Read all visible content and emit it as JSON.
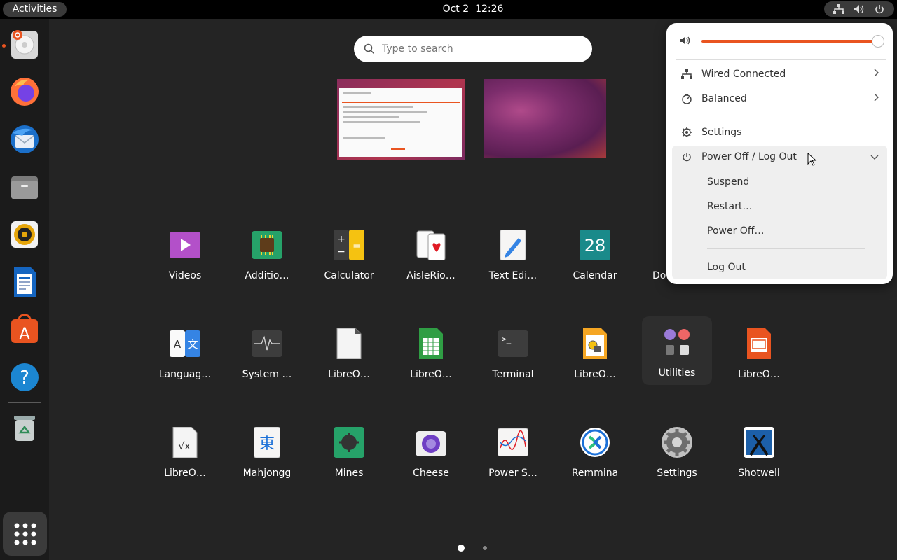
{
  "topbar": {
    "activities": "Activities",
    "date": "Oct 2",
    "time": "12:26"
  },
  "tray": {
    "icons": [
      "network-icon",
      "volume-icon",
      "power-icon"
    ]
  },
  "dock": {
    "items": [
      "Ubuntu Installer",
      "Firefox",
      "Thunderbird",
      "Files",
      "Rhythmbox",
      "LibreOffice Writer",
      "Ubuntu Software",
      "Help",
      "Trash"
    ],
    "show_apps": "Show Applications"
  },
  "search": {
    "placeholder": "Type to search"
  },
  "apps": {
    "row1": [
      "Videos",
      "Additio…",
      "Calculator",
      "AisleRio…",
      "Text Edi…",
      "Calendar",
      "Do"
    ],
    "row2": [
      "Languag…",
      "System …",
      "LibreO…",
      "LibreO…",
      "Terminal",
      "LibreO…",
      "Utilities",
      "LibreO…"
    ],
    "row3": [
      "LibreO…",
      "Mahjongg",
      "Mines",
      "Cheese",
      "Power S…",
      "Remmina",
      "Settings",
      "Shotwell"
    ]
  },
  "calendar_icon_day": "28",
  "quick_settings": {
    "volume_level": 1.0,
    "network": "Wired Connected",
    "power_mode": "Balanced",
    "settings": "Settings",
    "power_menu": "Power Off / Log Out",
    "suspend": "Suspend",
    "restart": "Restart…",
    "power_off": "Power Off…",
    "log_out": "Log Out"
  },
  "pages": {
    "count": 2,
    "current": 1
  },
  "colors": {
    "accent": "#e95420",
    "background": "#242424",
    "dock": "#1b1b1b"
  }
}
